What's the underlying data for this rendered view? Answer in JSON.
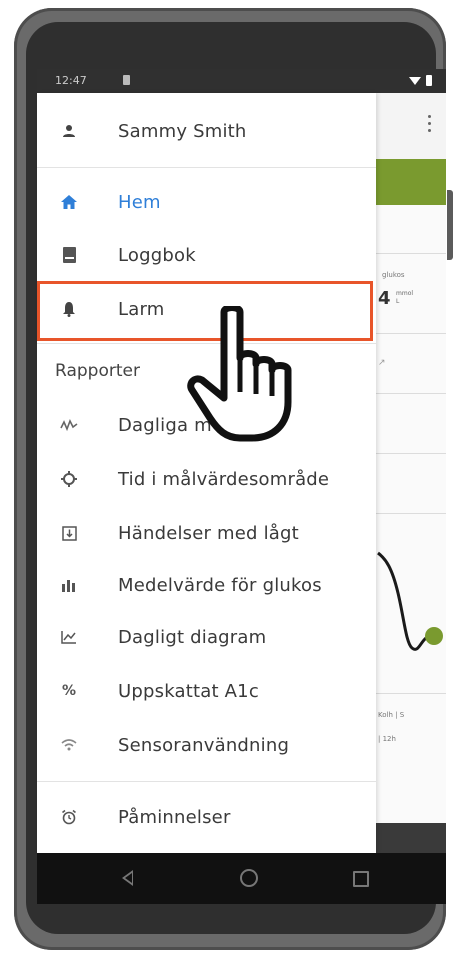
{
  "status_bar": {
    "time": "12:47"
  },
  "drawer": {
    "user_name": "Sammy Smith",
    "main_items": [
      {
        "label": "Hem",
        "icon": "home-icon",
        "active": true
      },
      {
        "label": "Loggbok",
        "icon": "logbook-icon",
        "active": false
      },
      {
        "label": "Larm",
        "icon": "bell-icon",
        "active": false
      }
    ],
    "reports_header": "Rapporter",
    "report_items": [
      {
        "label": "Dagliga m",
        "icon": "daily-patterns-icon"
      },
      {
        "label": "Tid i målvärdesområde",
        "icon": "target-range-icon"
      },
      {
        "label": "Händelser med lågt",
        "icon": "low-events-icon"
      },
      {
        "label": "Medelvärde för glukos",
        "icon": "bar-chart-icon"
      },
      {
        "label": "Dagligt diagram",
        "icon": "line-chart-icon"
      },
      {
        "label": "Uppskattat A1c",
        "icon": "percent-icon"
      },
      {
        "label": "Sensoranvändning",
        "icon": "wifi-signal-icon"
      }
    ],
    "bottom_items": [
      {
        "label": "Påminnelser",
        "icon": "alarm-clock-icon"
      }
    ],
    "highlighted_item": "Larm"
  },
  "background_app": {
    "panel_title": "glukos",
    "reading_value": "4",
    "reading_unit_top": "mmol",
    "reading_unit_bottom": "L",
    "footer_left_top": "Kolh | S",
    "footer_left_bottom": "| 12h",
    "accent_color": "#7a9a2f"
  },
  "colors": {
    "active_blue": "#2f7fd8",
    "highlight_orange": "#e8552a",
    "text": "#3a3a3a"
  }
}
